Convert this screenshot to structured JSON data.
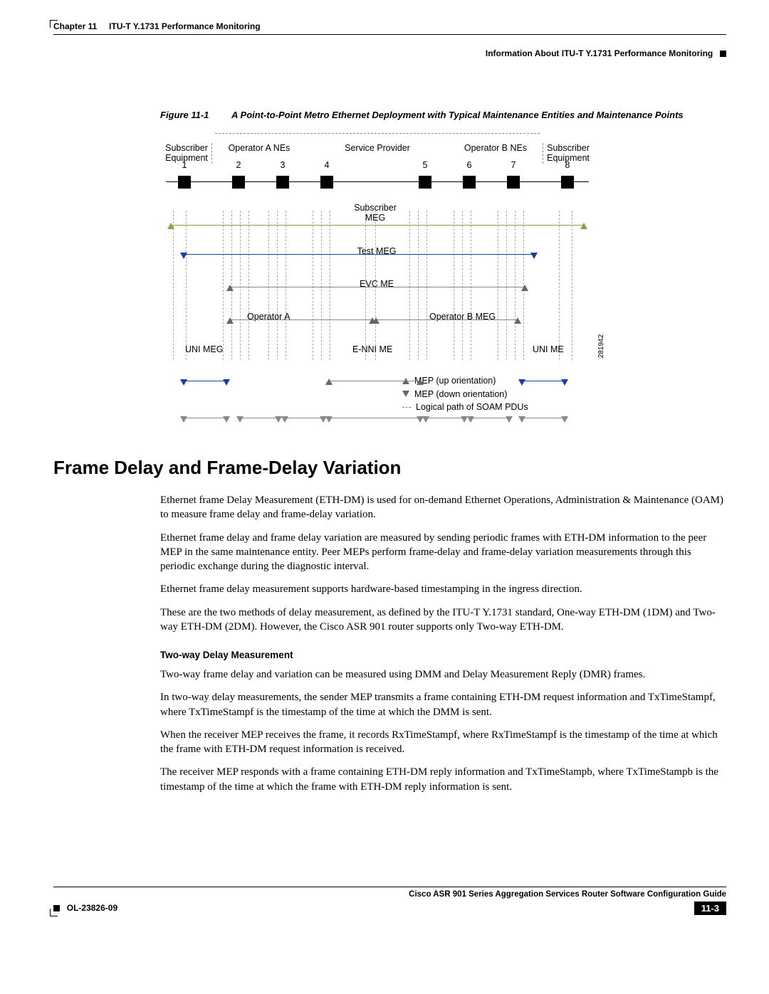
{
  "header": {
    "chapter": "Chapter 11",
    "chapter_title": "ITU-T Y.1731 Performance Monitoring",
    "section_right": "Information About ITU-T Y.1731 Performance Monitoring"
  },
  "figure": {
    "number": "Figure 11-1",
    "title": "A Point-to-Point Metro Ethernet Deployment with Typical Maintenance Entities and Maintenance Points",
    "labels": {
      "subscriber_equipment_left": "Subscriber\nEquipment",
      "operator_a_nes": "Operator A NEs",
      "service_provider": "Service Provider",
      "operator_b_nes": "Operator B NEs",
      "subscriber_equipment_right": "Subscriber\nEquipment",
      "subscriber_meg": "Subscriber\nMEG",
      "test_meg": "Test MEG",
      "evc_me": "EVC ME",
      "operator_a": "Operator A",
      "operator_b_meg": "Operator B MEG",
      "uni_meg": "UNI MEG",
      "enni_me": "E-NNI ME",
      "uni_me": "UNI ME"
    },
    "legend": {
      "mep_up": "MEP (up orientation)",
      "mep_down": "MEP (down orientation)",
      "logical_path": "Logical path of SOAM PDUs"
    },
    "side_number": "281942",
    "nodes": [
      "1",
      "2",
      "3",
      "4",
      "5",
      "6",
      "7",
      "8"
    ]
  },
  "heading": "Frame Delay and Frame-Delay Variation",
  "paragraphs": {
    "p1": "Ethernet frame Delay Measurement (ETH-DM) is used for on-demand Ethernet Operations, Administration & Maintenance (OAM) to measure frame delay and frame-delay variation.",
    "p2": "Ethernet frame delay and frame delay variation are measured by sending periodic frames with ETH-DM information to the peer MEP in the same maintenance entity. Peer MEPs perform frame-delay and frame-delay variation measurements through this periodic exchange during the diagnostic interval.",
    "p3": "Ethernet frame delay measurement supports hardware-based timestamping in the ingress direction.",
    "p4": "These are the two methods of delay measurement, as defined by the ITU-T Y.1731 standard, One-way ETH-DM (1DM) and Two-way ETH-DM (2DM). However, the Cisco ASR 901 router supports only Two-way ETH-DM."
  },
  "subheading": "Two-way Delay Measurement",
  "subparas": {
    "s1": "Two-way frame delay and variation can be measured using DMM and Delay Measurement Reply (DMR) frames.",
    "s2": "In two-way delay measurements, the sender MEP transmits a frame containing ETH-DM request information and TxTimeStampf, where TxTimeStampf is the timestamp of the time at which the DMM is sent.",
    "s3": "When the receiver MEP receives the frame, it records RxTimeStampf, where RxTimeStampf is the timestamp of the time at which the frame with ETH-DM request information is received.",
    "s4": "The receiver MEP responds with a frame containing ETH-DM reply information and TxTimeStampb, where TxTimeStampb is the timestamp of the time at which the frame with ETH-DM reply information is sent."
  },
  "footer": {
    "guide_title": "Cisco ASR 901 Series Aggregation Services Router Software Configuration Guide",
    "doc_id": "OL-23826-09",
    "page_num": "11-3"
  }
}
